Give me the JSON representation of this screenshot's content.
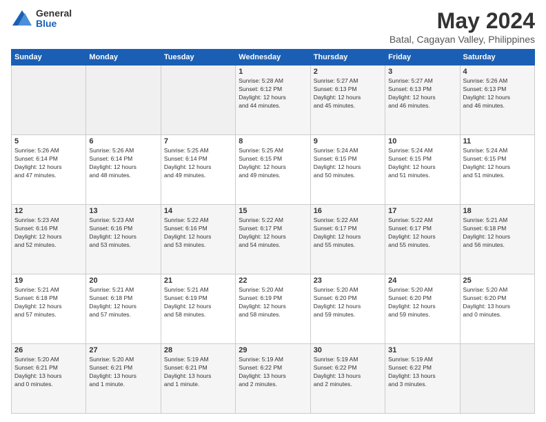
{
  "logo": {
    "general": "General",
    "blue": "Blue"
  },
  "title": "May 2024",
  "subtitle": "Batal, Cagayan Valley, Philippines",
  "days_header": [
    "Sunday",
    "Monday",
    "Tuesday",
    "Wednesday",
    "Thursday",
    "Friday",
    "Saturday"
  ],
  "weeks": [
    [
      {
        "day": "",
        "info": ""
      },
      {
        "day": "",
        "info": ""
      },
      {
        "day": "",
        "info": ""
      },
      {
        "day": "1",
        "info": "Sunrise: 5:28 AM\nSunset: 6:12 PM\nDaylight: 12 hours\nand 44 minutes."
      },
      {
        "day": "2",
        "info": "Sunrise: 5:27 AM\nSunset: 6:13 PM\nDaylight: 12 hours\nand 45 minutes."
      },
      {
        "day": "3",
        "info": "Sunrise: 5:27 AM\nSunset: 6:13 PM\nDaylight: 12 hours\nand 46 minutes."
      },
      {
        "day": "4",
        "info": "Sunrise: 5:26 AM\nSunset: 6:13 PM\nDaylight: 12 hours\nand 46 minutes."
      }
    ],
    [
      {
        "day": "5",
        "info": "Sunrise: 5:26 AM\nSunset: 6:14 PM\nDaylight: 12 hours\nand 47 minutes."
      },
      {
        "day": "6",
        "info": "Sunrise: 5:26 AM\nSunset: 6:14 PM\nDaylight: 12 hours\nand 48 minutes."
      },
      {
        "day": "7",
        "info": "Sunrise: 5:25 AM\nSunset: 6:14 PM\nDaylight: 12 hours\nand 49 minutes."
      },
      {
        "day": "8",
        "info": "Sunrise: 5:25 AM\nSunset: 6:15 PM\nDaylight: 12 hours\nand 49 minutes."
      },
      {
        "day": "9",
        "info": "Sunrise: 5:24 AM\nSunset: 6:15 PM\nDaylight: 12 hours\nand 50 minutes."
      },
      {
        "day": "10",
        "info": "Sunrise: 5:24 AM\nSunset: 6:15 PM\nDaylight: 12 hours\nand 51 minutes."
      },
      {
        "day": "11",
        "info": "Sunrise: 5:24 AM\nSunset: 6:15 PM\nDaylight: 12 hours\nand 51 minutes."
      }
    ],
    [
      {
        "day": "12",
        "info": "Sunrise: 5:23 AM\nSunset: 6:16 PM\nDaylight: 12 hours\nand 52 minutes."
      },
      {
        "day": "13",
        "info": "Sunrise: 5:23 AM\nSunset: 6:16 PM\nDaylight: 12 hours\nand 53 minutes."
      },
      {
        "day": "14",
        "info": "Sunrise: 5:22 AM\nSunset: 6:16 PM\nDaylight: 12 hours\nand 53 minutes."
      },
      {
        "day": "15",
        "info": "Sunrise: 5:22 AM\nSunset: 6:17 PM\nDaylight: 12 hours\nand 54 minutes."
      },
      {
        "day": "16",
        "info": "Sunrise: 5:22 AM\nSunset: 6:17 PM\nDaylight: 12 hours\nand 55 minutes."
      },
      {
        "day": "17",
        "info": "Sunrise: 5:22 AM\nSunset: 6:17 PM\nDaylight: 12 hours\nand 55 minutes."
      },
      {
        "day": "18",
        "info": "Sunrise: 5:21 AM\nSunset: 6:18 PM\nDaylight: 12 hours\nand 56 minutes."
      }
    ],
    [
      {
        "day": "19",
        "info": "Sunrise: 5:21 AM\nSunset: 6:18 PM\nDaylight: 12 hours\nand 57 minutes."
      },
      {
        "day": "20",
        "info": "Sunrise: 5:21 AM\nSunset: 6:18 PM\nDaylight: 12 hours\nand 57 minutes."
      },
      {
        "day": "21",
        "info": "Sunrise: 5:21 AM\nSunset: 6:19 PM\nDaylight: 12 hours\nand 58 minutes."
      },
      {
        "day": "22",
        "info": "Sunrise: 5:20 AM\nSunset: 6:19 PM\nDaylight: 12 hours\nand 58 minutes."
      },
      {
        "day": "23",
        "info": "Sunrise: 5:20 AM\nSunset: 6:20 PM\nDaylight: 12 hours\nand 59 minutes."
      },
      {
        "day": "24",
        "info": "Sunrise: 5:20 AM\nSunset: 6:20 PM\nDaylight: 12 hours\nand 59 minutes."
      },
      {
        "day": "25",
        "info": "Sunrise: 5:20 AM\nSunset: 6:20 PM\nDaylight: 13 hours\nand 0 minutes."
      }
    ],
    [
      {
        "day": "26",
        "info": "Sunrise: 5:20 AM\nSunset: 6:21 PM\nDaylight: 13 hours\nand 0 minutes."
      },
      {
        "day": "27",
        "info": "Sunrise: 5:20 AM\nSunset: 6:21 PM\nDaylight: 13 hours\nand 1 minute."
      },
      {
        "day": "28",
        "info": "Sunrise: 5:19 AM\nSunset: 6:21 PM\nDaylight: 13 hours\nand 1 minute."
      },
      {
        "day": "29",
        "info": "Sunrise: 5:19 AM\nSunset: 6:22 PM\nDaylight: 13 hours\nand 2 minutes."
      },
      {
        "day": "30",
        "info": "Sunrise: 5:19 AM\nSunset: 6:22 PM\nDaylight: 13 hours\nand 2 minutes."
      },
      {
        "day": "31",
        "info": "Sunrise: 5:19 AM\nSunset: 6:22 PM\nDaylight: 13 hours\nand 3 minutes."
      },
      {
        "day": "",
        "info": ""
      }
    ]
  ]
}
